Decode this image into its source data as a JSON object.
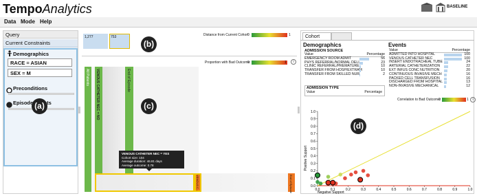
{
  "app": {
    "title_bold": "Tempo",
    "title_italic": "Analytics",
    "logo1": "VIRGINIA",
    "logo2": "BASELINE"
  },
  "menu": [
    "Data",
    "Mode",
    "Help"
  ],
  "left_panel": {
    "tab_query": "Query",
    "tab_constraints": "Current Constraints",
    "demographics_title": "Demographics",
    "fields": [
      "RACE = ASIAN",
      "SEX = M"
    ],
    "preconditions_label": "Preconditions",
    "episode_events_label": "Episode Events",
    "badge": "(a)"
  },
  "middle_panel": {
    "top_labels": [
      "1,277",
      "753"
    ],
    "distance_label": "Distance from Current Cohort",
    "proportion_label": "Proportion with Bad Outcome:",
    "legend_min": "0",
    "legend_max": "1",
    "badge_b": "(b)",
    "badge_c": "(c)",
    "bars": [
      "All Patients",
      "VENOUS CATHETER NEC = NO",
      "End of Episode"
    ],
    "bottom_labels": [
      "VENOUS C...",
      "End of Episode"
    ],
    "tooltip": {
      "title": "VENOUS CATHETER NEC = YES",
      "lines": [
        "Cohort size: 104",
        "Average duration: 46.81 days",
        "Average outcome: 0.78"
      ]
    }
  },
  "right_panel": {
    "tabs": [
      "Cohort",
      ""
    ],
    "demographics_heading": "Demographics",
    "events_heading": "Events",
    "admission_source_label": "ADMISSION SOURCE",
    "admission_type_label": "ADMISSION TYPE",
    "col_value": "Value",
    "col_percentage": "Percentage",
    "demo_rows": [
      {
        "name": "EMERGENCY ROOM ADMIT",
        "value": "56"
      },
      {
        "name": "PHYS REFERRAL/NORMAL DELI",
        "value": "23"
      },
      {
        "name": "CLINIC REFERRAL/PREMATURE",
        "value": "10"
      },
      {
        "name": "TRANSFER FROM HOSP/EXTRAM",
        "value": "10"
      },
      {
        "name": "TRANSFER FROM SKILLED NUR",
        "value": "2"
      }
    ],
    "event_rows": [
      {
        "name": "ADMITTED INTO HOSPITAL",
        "value": "100"
      },
      {
        "name": "VENOUS CATHETER NEC",
        "value": "100"
      },
      {
        "name": "INSERT ENDOTRACHEAL TUBE",
        "value": "24"
      },
      {
        "name": "ARTERIAL CATHETERIZATION",
        "value": "22"
      },
      {
        "name": "EXT INFUS CONC NUTRITION",
        "value": "20"
      },
      {
        "name": "CONTINUOUS INVASIVE MECH",
        "value": "16"
      },
      {
        "name": "PACKED CELL TRANSFUSION",
        "value": "16"
      },
      {
        "name": "DISCHARGED FROM HOSPITAL",
        "value": "13"
      },
      {
        "name": "NON-INVASIVE MECHANICAL",
        "value": "12"
      }
    ],
    "correlation_label": "Correlation to Bad Outcome:",
    "badge_d": "(d)",
    "y_axis_label": "Positive Support",
    "x_axis_label": "Negative Support",
    "y_ticks": [
      "0.0",
      "0.1",
      "0.2",
      "0.3",
      "0.4",
      "0.5",
      "0.6",
      "0.7",
      "0.8",
      "0.9",
      "1.0"
    ],
    "x_ticks": [
      "0.0",
      "0.1",
      "0.2",
      "0.3",
      "0.4",
      "0.5",
      "0.6",
      "0.7",
      "0.8",
      "0.9",
      "1.0"
    ]
  },
  "chart_data": {
    "type": "scatter",
    "xlabel": "Negative Support",
    "ylabel": "Positive Support",
    "xlim": [
      0,
      1
    ],
    "ylim": [
      0,
      1
    ],
    "points": [
      {
        "x": 0.0,
        "y": 0.14,
        "color": "#2a9a3a"
      },
      {
        "x": 0.0,
        "y": 0.05,
        "color": "#2a9a3a"
      },
      {
        "x": 0.02,
        "y": 0.03,
        "color": "#2a9a3a"
      },
      {
        "x": 0.07,
        "y": 0.12,
        "color": "#8dc63f"
      },
      {
        "x": 0.1,
        "y": 0.05,
        "color": "#e0301e"
      },
      {
        "x": 0.12,
        "y": 0.03,
        "color": "#e0301e"
      },
      {
        "x": 0.15,
        "y": 0.15,
        "color": "#c8d850"
      },
      {
        "x": 0.18,
        "y": 0.1,
        "color": "#e0301e"
      },
      {
        "x": 0.22,
        "y": 0.15,
        "color": "#e0301e"
      },
      {
        "x": 0.25,
        "y": 0.18,
        "color": "#e0301e"
      },
      {
        "x": 0.28,
        "y": 0.08,
        "color": "#e0301e"
      },
      {
        "x": 0.3,
        "y": 0.2,
        "color": "#e0301e"
      },
      {
        "x": 0.33,
        "y": 0.14,
        "color": "#e0301e"
      }
    ],
    "ringed_points": [
      {
        "x": 0.0,
        "y": 0.14,
        "color": "#2a9a3a"
      },
      {
        "x": 0.07,
        "y": 0.04,
        "color": "#e0301e"
      },
      {
        "x": 0.1,
        "y": 0.04,
        "color": "#e0301e"
      },
      {
        "x": 0.28,
        "y": 0.08,
        "color": "#e0301e"
      }
    ],
    "reference_line": {
      "from": [
        0,
        0
      ],
      "to": [
        1,
        1
      ],
      "color": "#e8e030"
    }
  }
}
